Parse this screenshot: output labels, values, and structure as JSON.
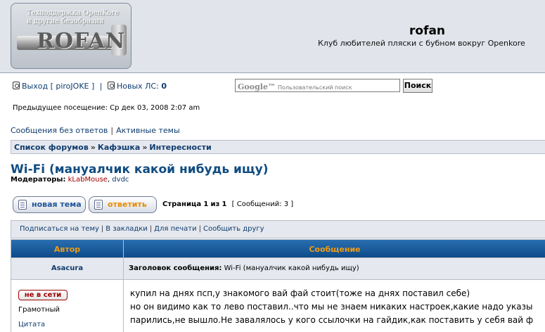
{
  "header": {
    "logo_line1": "Техподдержка OpenKore",
    "logo_line2": "и другие безобразия",
    "logo_word": "ROFAN",
    "site_title": "rofan",
    "site_description": "Клуб любителей пляски с бубном вокруг Openkore"
  },
  "topbar": {
    "logout_label": "Выход [ piroJOKE ]",
    "pm_label": "Новых ЛС:",
    "pm_count": "0"
  },
  "search": {
    "brand": "Google™",
    "placeholder": "Пользовательский поиск",
    "button_label": "Поиск"
  },
  "prev_visit": "Предыдущее посещение: Ср дек 03, 2008 2:07 am",
  "quick_links": [
    "Сообщения без ответов",
    "Активные темы"
  ],
  "breadcrumb": [
    "Список форумов",
    "Кафэшка",
    "Интересности"
  ],
  "topic": {
    "title": "Wi-Fi (мануалчик какой нибудь ищу)",
    "moderators_label": "Модераторы:",
    "moderator1": "kLabMouse",
    "moderator2": "dvdc"
  },
  "buttons": {
    "new_topic": "новая тема",
    "reply": "ответить"
  },
  "pagination": {
    "label": "Страница",
    "current": "1",
    "of": "из",
    "total": "1",
    "count_text": "[ Сообщений: 3 ]"
  },
  "actions": [
    "Подписаться на тему",
    "В закладки",
    "Для печати",
    "Сообщить другу"
  ],
  "table": {
    "col_author": "Автор",
    "col_message": "Сообщение"
  },
  "post": {
    "author": "Asacura",
    "subject_label": "Заголовок сообщения:",
    "subject": "Wi-Fi (мануалчик какой нибудь ищу)",
    "status": "не в сети",
    "rank": "Грамотный",
    "quote_link": "Цитата",
    "body_line1": "купил на днях псп,у знакомого вай фай стоит(тоже на днях поставил себе)",
    "body_line2": "но он видимо как то лево поставил..что мы не знаем никаких настроек,какие надо указы",
    "body_line3": "парились,не вышло.Не завалялось у кого ссылочки на гайдик,как поставить у себя вай ф"
  }
}
